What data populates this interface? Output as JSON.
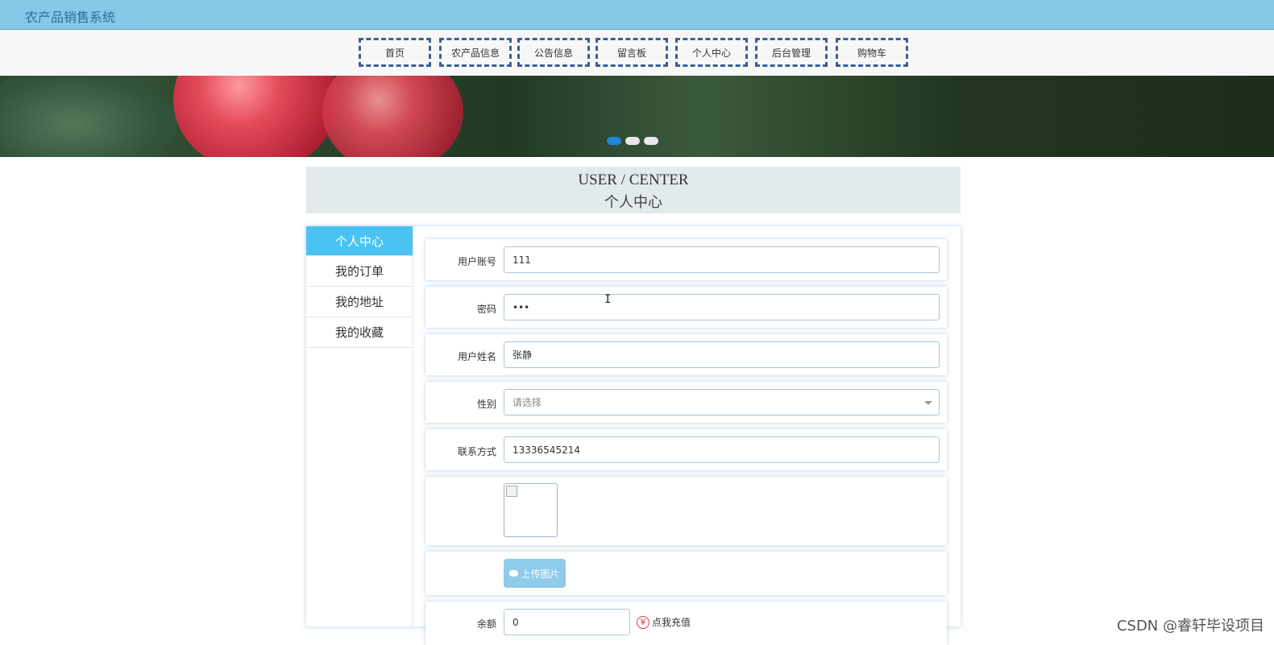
{
  "header": {
    "app_title": "农产品销售系统"
  },
  "nav": {
    "items": [
      "首页",
      "农产品信息",
      "公告信息",
      "留言板",
      "个人中心",
      "后台管理",
      "购物车"
    ]
  },
  "banner": {
    "slides": 3,
    "active_slide": 0
  },
  "center": {
    "title_en": "USER / CENTER",
    "title_cn": "个人中心"
  },
  "sidebar": {
    "items": [
      {
        "label": "个人中心",
        "active": true
      },
      {
        "label": "我的订单",
        "active": false
      },
      {
        "label": "我的地址",
        "active": false
      },
      {
        "label": "我的收藏",
        "active": false
      }
    ]
  },
  "form": {
    "account": {
      "label": "用户账号",
      "value": "111"
    },
    "password": {
      "label": "密码",
      "value": "•••"
    },
    "name": {
      "label": "用户姓名",
      "value": "张静"
    },
    "gender": {
      "label": "性别",
      "placeholder": "请选择"
    },
    "phone": {
      "label": "联系方式",
      "value": "13336545214"
    },
    "upload": {
      "label": "上传图片"
    },
    "balance": {
      "label": "余额",
      "value": "0",
      "recharge": "点我充值",
      "recharge_icon": "¥"
    }
  },
  "watermark": "CSDN @睿轩毕设项目",
  "colors": {
    "topbar": "#87c7e8",
    "active_menu": "#4ac3f3",
    "nav_border": "#3d5f93",
    "upload_btn": "#90cbe9"
  }
}
